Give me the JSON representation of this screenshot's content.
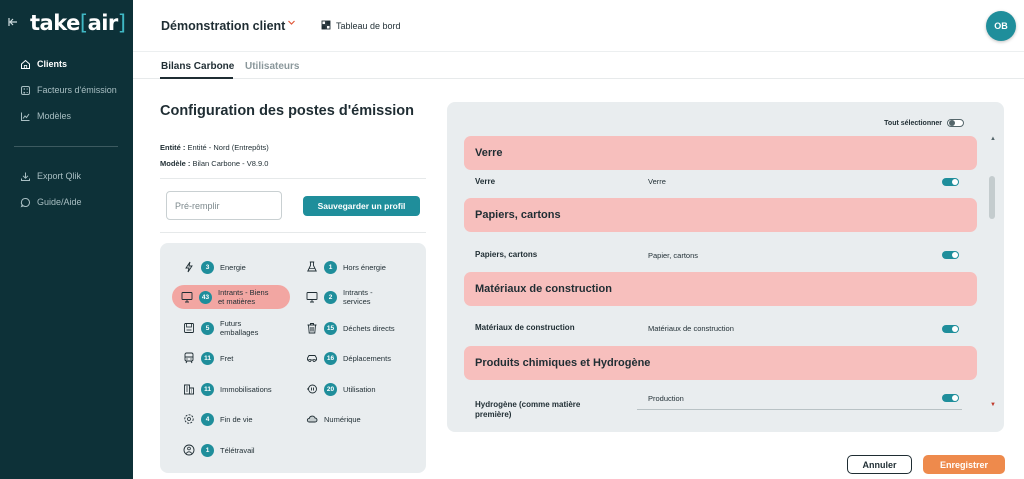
{
  "sidebar": {
    "logo": {
      "prefix": "take",
      "bracket_open": "[",
      "name": "air",
      "bracket_close": "]"
    },
    "items_main": [
      {
        "label": "Clients",
        "icon": "home-icon",
        "active": true
      },
      {
        "label": "Facteurs d'émission",
        "icon": "calculator-icon",
        "active": false
      },
      {
        "label": "Modèles",
        "icon": "chart-icon",
        "active": false
      }
    ],
    "items_secondary": [
      {
        "label": "Export Qlik",
        "icon": "download-icon"
      },
      {
        "label": "Guide/Aide",
        "icon": "chat-icon"
      }
    ]
  },
  "header": {
    "client_name": "Démonstration client",
    "dashboard_label": "Tableau de bord",
    "avatar_initials": "OB"
  },
  "tabs": [
    {
      "label": "Bilans Carbone",
      "active": true
    },
    {
      "label": "Utilisateurs",
      "active": false
    }
  ],
  "config": {
    "title": "Configuration des postes d'émission",
    "entity_label": "Entité :",
    "entity_value": "Entité - Nord (Entrepôts)",
    "model_label": "Modèle :",
    "model_value": "Bilan Carbone - V8.9.0",
    "prefill_placeholder": "Pré-remplir",
    "save_profile_label": "Sauvegarder un profil"
  },
  "categories": [
    {
      "label_lines": [
        "Energie"
      ],
      "count": "3",
      "icon": "lightning-icon",
      "active": false
    },
    {
      "label_lines": [
        "Hors énergie"
      ],
      "count": "1",
      "icon": "flask-icon",
      "active": false
    },
    {
      "label_lines": [
        "Intrants - Biens",
        "et matières"
      ],
      "count": "43",
      "icon": "monitor-icon",
      "active": true
    },
    {
      "label_lines": [
        "Intrants -",
        "services"
      ],
      "count": "2",
      "icon": "monitor-icon",
      "active": false
    },
    {
      "label_lines": [
        "Futurs",
        "emballages"
      ],
      "count": "5",
      "icon": "package-icon",
      "active": false
    },
    {
      "label_lines": [
        "Déchets directs"
      ],
      "count": "15",
      "icon": "trash-icon",
      "active": false
    },
    {
      "label_lines": [
        "Fret"
      ],
      "count": "11",
      "icon": "train-icon",
      "active": false
    },
    {
      "label_lines": [
        "Déplacements"
      ],
      "count": "16",
      "icon": "car-icon",
      "active": false
    },
    {
      "label_lines": [
        "Immobilisations"
      ],
      "count": "11",
      "icon": "building-icon",
      "active": false
    },
    {
      "label_lines": [
        "Utilisation"
      ],
      "count": "20",
      "icon": "plug-icon",
      "active": false
    },
    {
      "label_lines": [
        "Fin de vie"
      ],
      "count": "4",
      "icon": "recycle-icon",
      "active": false
    },
    {
      "label_lines": [
        "Numérique"
      ],
      "count": "",
      "icon": "cloud-icon",
      "active": false
    },
    {
      "label_lines": [
        "Télétravail"
      ],
      "count": "1",
      "icon": "person-laptop-icon",
      "active": false
    }
  ],
  "emissions": {
    "select_all_label": "Tout sélectionner",
    "select_all_on": false,
    "groups": [
      {
        "title": "Verre",
        "rows": [
          {
            "label": "Verre",
            "value": "Verre",
            "on": true
          }
        ]
      },
      {
        "title": "Papiers, cartons",
        "rows": [
          {
            "label": "Papiers, cartons",
            "value": "Papier, cartons",
            "on": true
          }
        ]
      },
      {
        "title": "Matériaux de construction",
        "rows": [
          {
            "label": "Matériaux de construction",
            "value": "Matériaux de construction",
            "on": true
          }
        ]
      },
      {
        "title": "Produits chimiques et Hydrogène",
        "rows": [
          {
            "label": "Hydrogène (comme matière première)",
            "value": "Production",
            "on": true
          }
        ]
      }
    ]
  },
  "footer": {
    "cancel_label": "Annuler",
    "save_label": "Enregistrer"
  },
  "colors": {
    "sidebar_bg": "#0d3138",
    "accent_teal": "#1f8e9b",
    "group_header_pink": "#f7bfbd",
    "active_category_pink": "#f2a6a2",
    "save_orange": "#ee8a4c"
  }
}
